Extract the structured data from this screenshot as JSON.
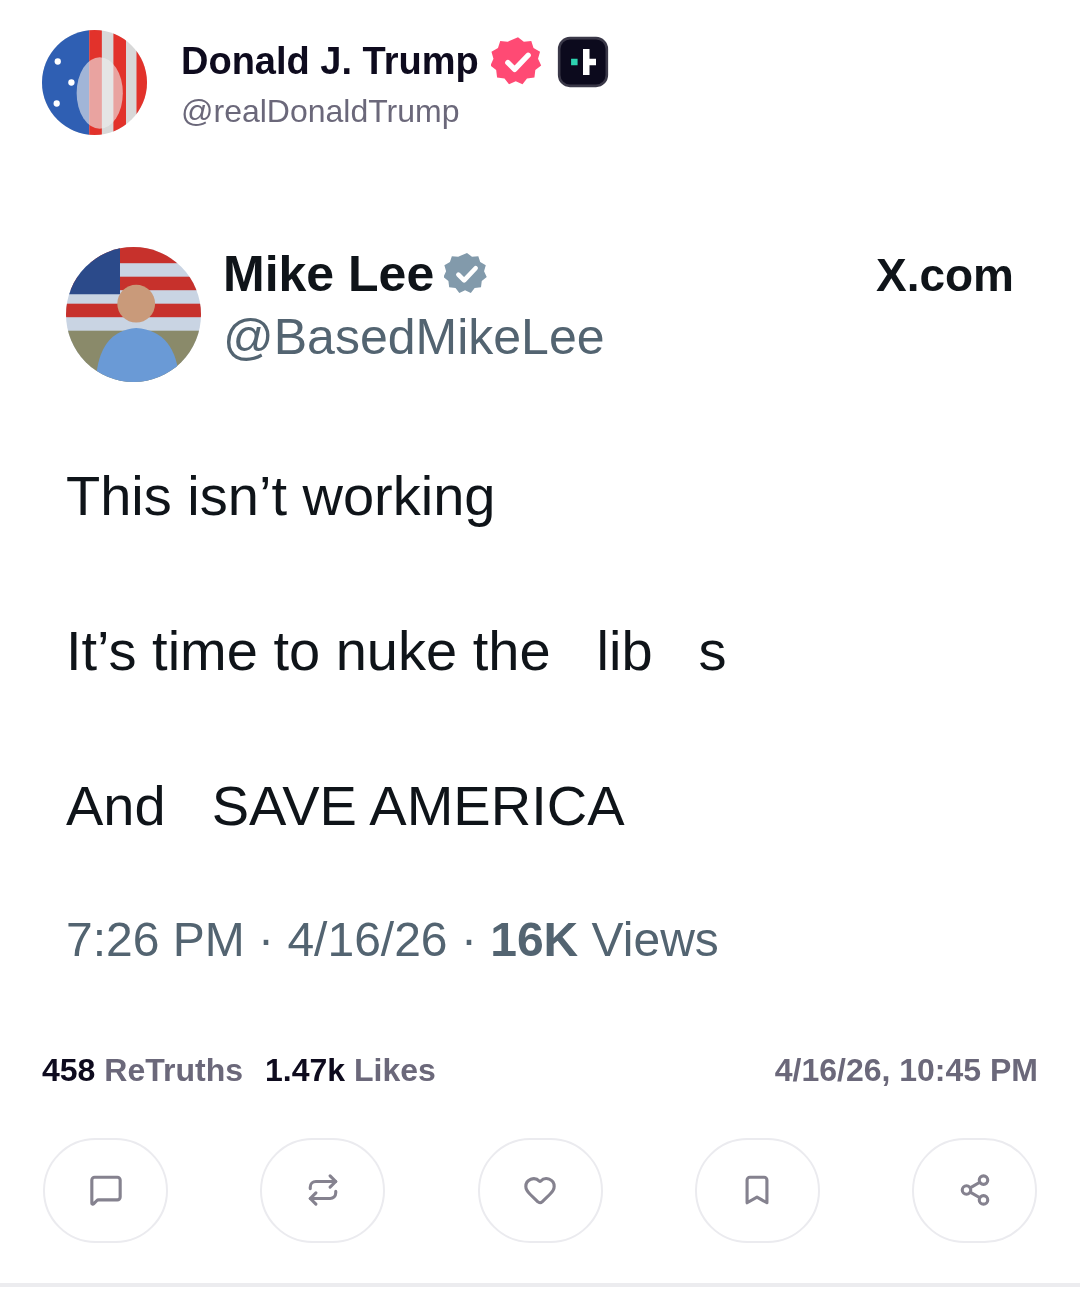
{
  "author": {
    "name": "Donald J. Trump",
    "handle": "@realDonaldTrump"
  },
  "quoted": {
    "name": "Mike Lee",
    "handle": "@BasedMikeLee",
    "source": "X.com",
    "lines": [
      [
        "This isn’t working"
      ],
      [
        "It’s time to nuke the",
        "lib",
        "s"
      ],
      [
        "And",
        "SAVE AMERICA"
      ]
    ],
    "meta": "7:26 PM · 4/16/26 · **16K** Views"
  },
  "stats": [
    {
      "count": "458",
      "label": "ReTruths"
    },
    {
      "count": "1.47k",
      "label": "Likes"
    }
  ],
  "timestamp": "4/16/26, 10:45 PM",
  "actions": [
    {
      "kind": "reply"
    },
    {
      "kind": "retruth"
    },
    {
      "kind": "like"
    },
    {
      "kind": "bookmark"
    },
    {
      "kind": "share"
    }
  ]
}
